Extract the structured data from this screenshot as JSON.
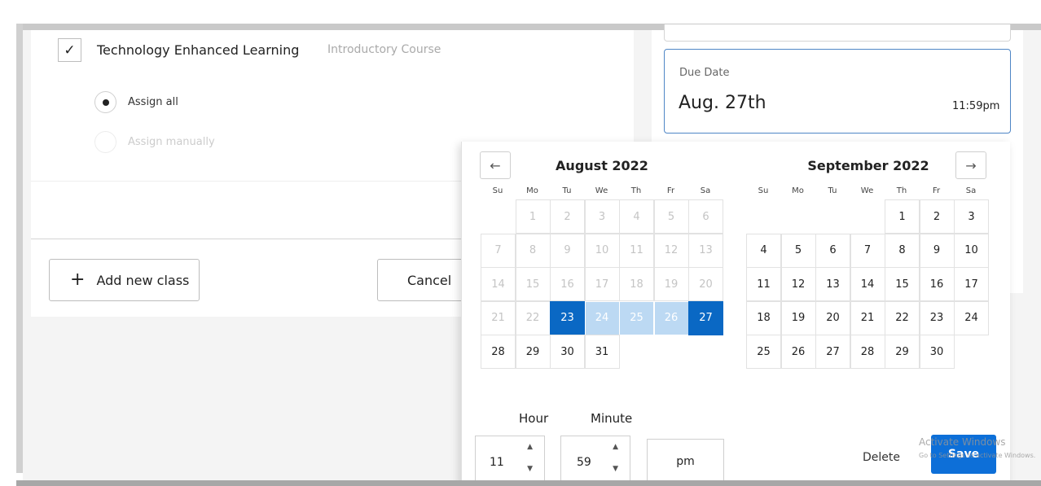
{
  "classes": {
    "item": {
      "name": "Technology Enhanced Learning",
      "type": "Introductory Course",
      "checked": true
    },
    "assign_all": "Assign all",
    "assign_manually": "Assign manually",
    "add_class": "Add new class",
    "cancel": "Cancel"
  },
  "due_date": {
    "label": "Due Date",
    "value": "Aug. 27th",
    "time": "11:59pm"
  },
  "calendar": {
    "prev_icon": "arrow-left-icon",
    "next_icon": "arrow-right-icon",
    "weekdays": [
      "Su",
      "Mo",
      "Tu",
      "We",
      "Th",
      "Fr",
      "Sa"
    ],
    "months": [
      {
        "title": "August 2022",
        "weeks": [
          [
            null,
            {
              "d": "1",
              "s": "past"
            },
            {
              "d": "2",
              "s": "past"
            },
            {
              "d": "3",
              "s": "past"
            },
            {
              "d": "4",
              "s": "past"
            },
            {
              "d": "5",
              "s": "past"
            },
            {
              "d": "6",
              "s": "past"
            }
          ],
          [
            {
              "d": "7",
              "s": "past"
            },
            {
              "d": "8",
              "s": "past"
            },
            {
              "d": "9",
              "s": "past"
            },
            {
              "d": "10",
              "s": "past"
            },
            {
              "d": "11",
              "s": "past"
            },
            {
              "d": "12",
              "s": "past"
            },
            {
              "d": "13",
              "s": "past"
            }
          ],
          [
            {
              "d": "14",
              "s": "past"
            },
            {
              "d": "15",
              "s": "past"
            },
            {
              "d": "16",
              "s": "past"
            },
            {
              "d": "17",
              "s": "past"
            },
            {
              "d": "18",
              "s": "past"
            },
            {
              "d": "19",
              "s": "past"
            },
            {
              "d": "20",
              "s": "past"
            }
          ],
          [
            {
              "d": "21",
              "s": "past"
            },
            {
              "d": "22",
              "s": "past"
            },
            {
              "d": "23",
              "s": "selected"
            },
            {
              "d": "24",
              "s": "range"
            },
            {
              "d": "25",
              "s": "range"
            },
            {
              "d": "26",
              "s": "range"
            },
            {
              "d": "27",
              "s": "selected"
            }
          ],
          [
            {
              "d": "28",
              "s": ""
            },
            {
              "d": "29",
              "s": ""
            },
            {
              "d": "30",
              "s": ""
            },
            {
              "d": "31",
              "s": ""
            },
            null,
            null,
            null
          ]
        ]
      },
      {
        "title": "September 2022",
        "weeks": [
          [
            null,
            null,
            null,
            null,
            {
              "d": "1",
              "s": ""
            },
            {
              "d": "2",
              "s": ""
            },
            {
              "d": "3",
              "s": ""
            }
          ],
          [
            {
              "d": "4",
              "s": ""
            },
            {
              "d": "5",
              "s": ""
            },
            {
              "d": "6",
              "s": ""
            },
            {
              "d": "7",
              "s": ""
            },
            {
              "d": "8",
              "s": ""
            },
            {
              "d": "9",
              "s": ""
            },
            {
              "d": "10",
              "s": ""
            }
          ],
          [
            {
              "d": "11",
              "s": ""
            },
            {
              "d": "12",
              "s": ""
            },
            {
              "d": "13",
              "s": ""
            },
            {
              "d": "14",
              "s": ""
            },
            {
              "d": "15",
              "s": ""
            },
            {
              "d": "16",
              "s": ""
            },
            {
              "d": "17",
              "s": ""
            }
          ],
          [
            {
              "d": "18",
              "s": ""
            },
            {
              "d": "19",
              "s": ""
            },
            {
              "d": "20",
              "s": ""
            },
            {
              "d": "21",
              "s": ""
            },
            {
              "d": "22",
              "s": ""
            },
            {
              "d": "23",
              "s": ""
            },
            {
              "d": "24",
              "s": ""
            }
          ],
          [
            {
              "d": "25",
              "s": ""
            },
            {
              "d": "26",
              "s": ""
            },
            {
              "d": "27",
              "s": ""
            },
            {
              "d": "28",
              "s": ""
            },
            {
              "d": "29",
              "s": ""
            },
            {
              "d": "30",
              "s": ""
            },
            null
          ]
        ]
      }
    ]
  },
  "time": {
    "hour_label": "Hour",
    "minute_label": "Minute",
    "hour": "11",
    "minute": "59",
    "ampm": "pm"
  },
  "actions": {
    "delete": "Delete",
    "save": "Save"
  },
  "watermark": {
    "line1": "Activate Windows",
    "line2": "Go to Settings to activate Windows."
  },
  "colors": {
    "selected": "#0a68c4",
    "range": "#bcd9f3",
    "save": "#0d6fd8"
  }
}
